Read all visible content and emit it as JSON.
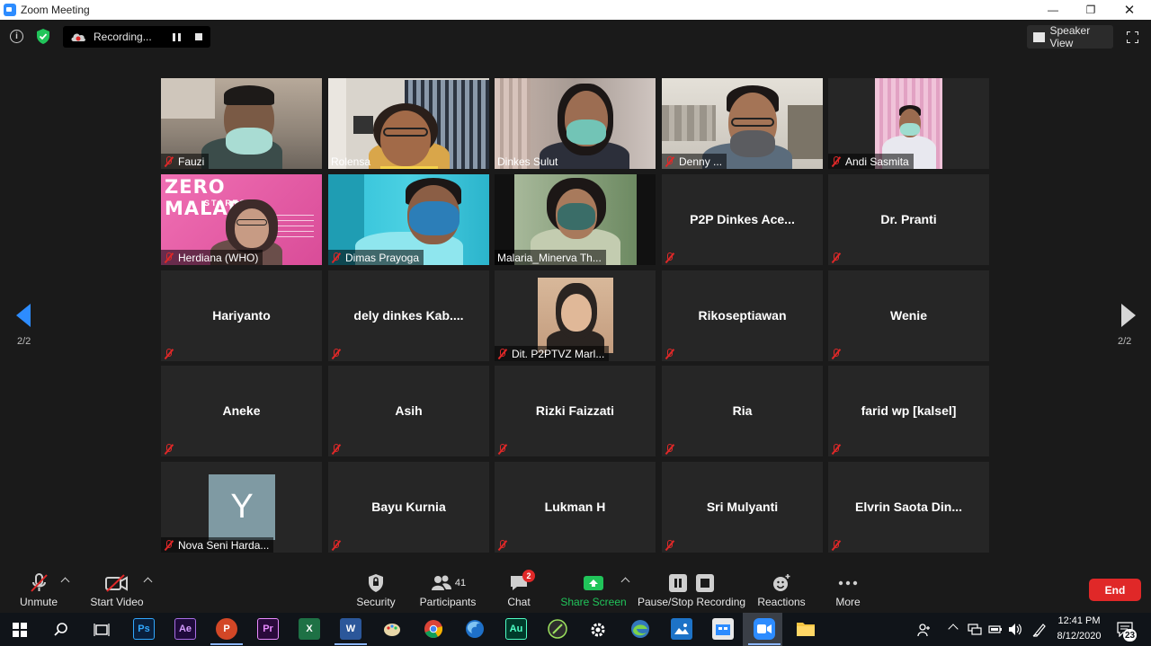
{
  "window": {
    "title": "Zoom Meeting"
  },
  "topbar": {
    "recording_label": "Recording...",
    "speaker_view_label": "Speaker View"
  },
  "gallery": {
    "page_left": "2/2",
    "page_right": "2/2",
    "tiles": [
      {
        "name": "Fauzi",
        "video": true
      },
      {
        "name": "Rolensa",
        "video": true
      },
      {
        "name": "Dinkes Sulut",
        "video": true
      },
      {
        "name": "Denny ...",
        "video": true
      },
      {
        "name": "Andi Sasmita",
        "video": true
      },
      {
        "name": "Herdiana (WHO)",
        "video": true,
        "banner_title": "ZERO MALARIA",
        "banner_sub": "STARTS"
      },
      {
        "name": "Dimas Prayoga",
        "video": true
      },
      {
        "name": "Malaria_Minerva Th...",
        "video": true
      },
      {
        "name": "P2P Dinkes Ace...",
        "video": false
      },
      {
        "name": "Dr. Pranti",
        "video": false
      },
      {
        "name": "Hariyanto",
        "video": false
      },
      {
        "name": "dely  dinkes  Kab....",
        "video": false
      },
      {
        "name": "Dit. P2PTVZ Marl...",
        "video": true
      },
      {
        "name": "Rikoseptiawan",
        "video": false
      },
      {
        "name": "Wenie",
        "video": false
      },
      {
        "name": "Aneke",
        "video": false
      },
      {
        "name": "Asih",
        "video": false
      },
      {
        "name": "Rizki Faizzati",
        "video": false
      },
      {
        "name": "Ria",
        "video": false
      },
      {
        "name": "farid wp [kalsel]",
        "video": false
      },
      {
        "name": "Nova Seni Harda...",
        "video": false,
        "avatar_letter": "Y"
      },
      {
        "name": "Bayu Kurnia",
        "video": false
      },
      {
        "name": "Lukman H",
        "video": false
      },
      {
        "name": "Sri Mulyanti",
        "video": false
      },
      {
        "name": "Elvrin  Saota  Din...",
        "video": false
      }
    ]
  },
  "toolbar": {
    "unmute": "Unmute",
    "start_video": "Start Video",
    "security": "Security",
    "participants": "Participants",
    "participants_count": "41",
    "chat": "Chat",
    "chat_badge": "2",
    "share_screen": "Share Screen",
    "pause_stop_recording": "Pause/Stop Recording",
    "reactions": "Reactions",
    "more": "More",
    "end": "End"
  },
  "taskbar": {
    "apps": [
      "start-icon",
      "search-icon",
      "task-view-icon",
      "photoshop-icon",
      "after-effects-icon",
      "powerpoint-icon",
      "premiere-icon",
      "excel-icon",
      "word-icon",
      "paint-icon",
      "chrome-icon",
      "firefox-icon",
      "audition-icon",
      "sketch-icon",
      "settings-icon",
      "edge-icon",
      "photos-icon",
      "store-icon",
      "zoom-icon",
      "file-explorer-icon"
    ],
    "time": "12:41 PM",
    "date": "8/12/2020",
    "notification_count": "23"
  },
  "colors": {
    "accent": "#2d8cff",
    "end_red": "#e02828",
    "share_green": "#21c45a",
    "speaking_yellow": "#f5d24b"
  }
}
